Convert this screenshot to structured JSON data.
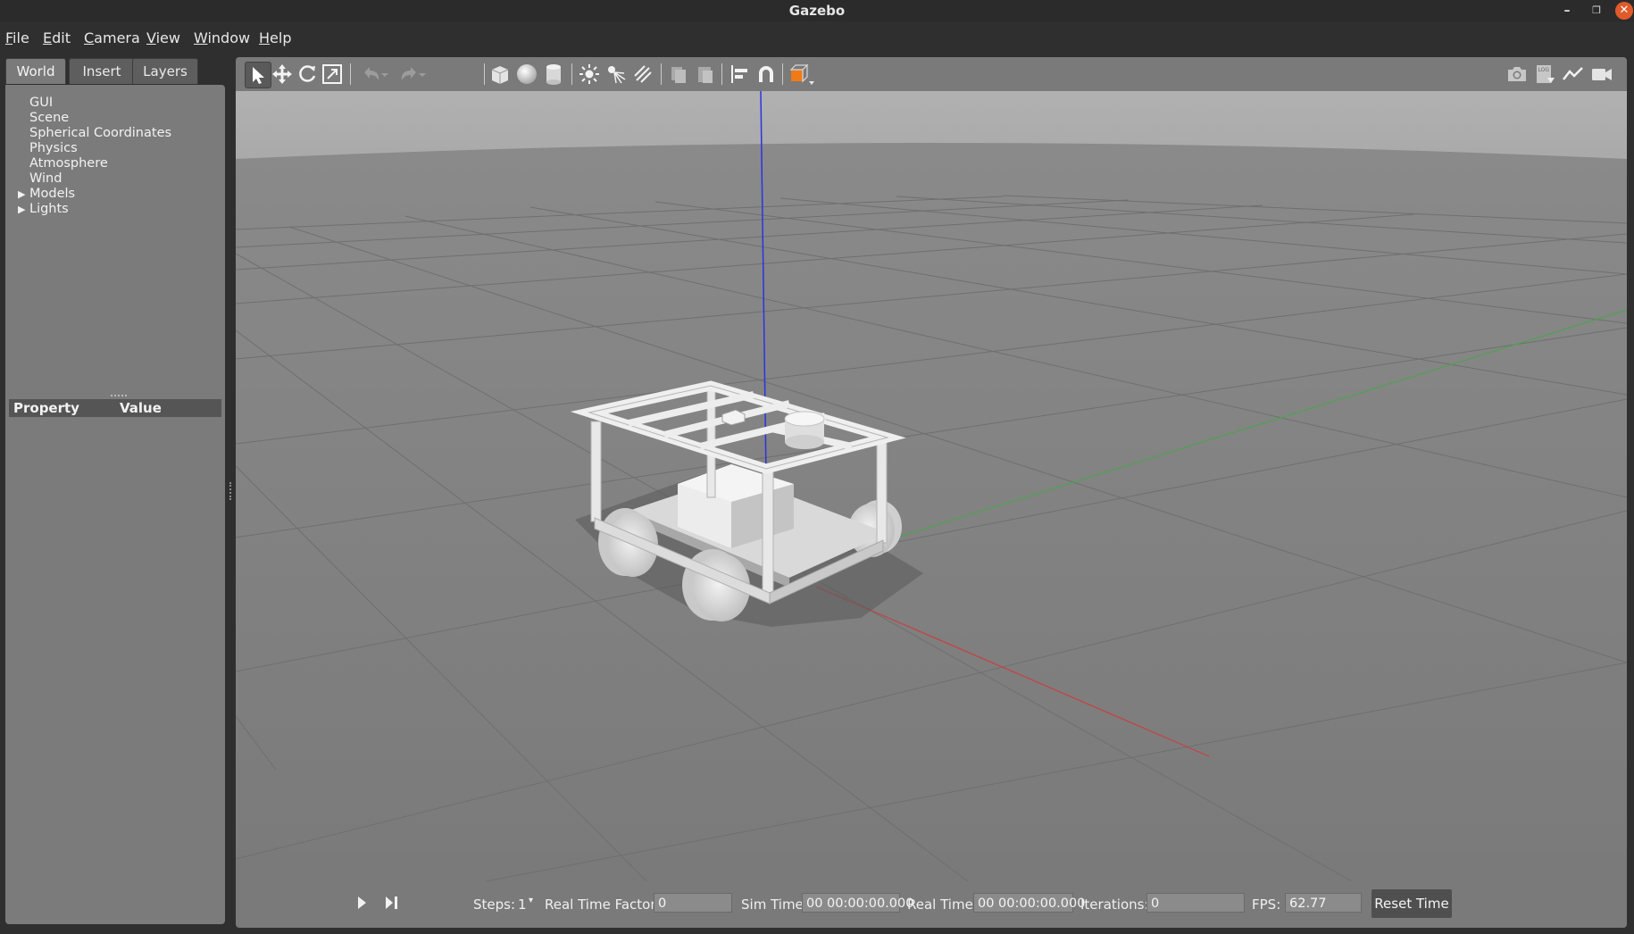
{
  "window": {
    "title": "Gazebo"
  },
  "menu": {
    "items": [
      {
        "first": "F",
        "rest": "ile"
      },
      {
        "first": "E",
        "rest": "dit"
      },
      {
        "first": "C",
        "rest": "amera"
      },
      {
        "first": "V",
        "rest": "iew"
      },
      {
        "first": "W",
        "rest": "indow"
      },
      {
        "first": "H",
        "rest": "elp"
      }
    ]
  },
  "left_panel": {
    "tabs": [
      "World",
      "Insert",
      "Layers"
    ],
    "active_tab": "World",
    "tree": [
      "GUI",
      "Scene",
      "Spherical Coordinates",
      "Physics",
      "Atmosphere",
      "Wind",
      "Models",
      "Lights"
    ],
    "property_header": {
      "property": "Property",
      "value": "Value"
    }
  },
  "toolbar": {
    "icons": [
      "select-icon",
      "translate-icon",
      "rotate-icon",
      "scale-icon",
      "undo-icon",
      "redo-icon",
      "box-icon",
      "sphere-icon",
      "cylinder-icon",
      "point-light-icon",
      "spot-light-icon",
      "directional-light-icon",
      "copy-icon",
      "paste-icon",
      "align-icon",
      "snap-icon",
      "view-angle-icon",
      "screenshot-icon",
      "log-icon",
      "plot-icon",
      "video-record-icon"
    ]
  },
  "bottom_bar": {
    "steps_label": "Steps:",
    "steps_value": "1",
    "rtf_label": "Real Time Factor:",
    "rtf_value": "0",
    "sim_time_label": "Sim Time:",
    "sim_time_value": "00 00:00:00.000",
    "real_time_label": "Real Time:",
    "real_time_value": "00 00:00:00.000",
    "iterations_label": "Iterations:",
    "iterations_value": "0",
    "fps_label": "FPS:",
    "fps_value": "62.77",
    "reset_label": "Reset Time"
  },
  "colors": {
    "x_axis": "#d23a3a",
    "y_axis": "#3fae3f",
    "z_axis": "#1f2ee0",
    "orange_accent": "#f07a18"
  }
}
